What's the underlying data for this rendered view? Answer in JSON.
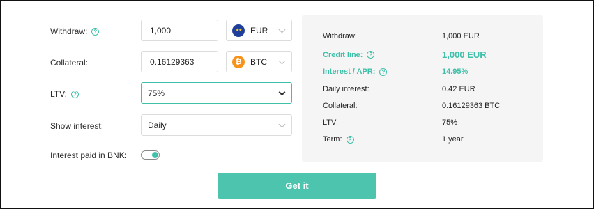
{
  "form": {
    "withdraw_label": "Withdraw:",
    "withdraw_value": "1,000",
    "withdraw_currency": "EUR",
    "collateral_label": "Collateral:",
    "collateral_value": "0.16129363",
    "collateral_currency": "BTC",
    "ltv_label": "LTV:",
    "ltv_value": "75%",
    "show_interest_label": "Show interest:",
    "show_interest_value": "Daily",
    "interest_bnk_label": "Interest paid in BNK:",
    "interest_bnk_on": true
  },
  "summary": {
    "withdraw_label": "Withdraw:",
    "withdraw_value": "1,000 EUR",
    "credit_line_label": "Credit line:",
    "credit_line_value": "1,000 EUR",
    "apr_label": "Interest / APR:",
    "apr_value": "14.95%",
    "daily_label": "Daily interest:",
    "daily_value": "0.42 EUR",
    "collateral_label": "Collateral:",
    "collateral_value": "0.16129363 BTC",
    "ltv_label": "LTV:",
    "ltv_value": "75%",
    "term_label": "Term:",
    "term_value": "1 year"
  },
  "cta_label": "Get it",
  "icons": {
    "help": "question-circle-icon",
    "eur": "eu-flag-icon",
    "btc": "bitcoin-icon",
    "chevron": "chevron-down-icon"
  },
  "colors": {
    "accent": "#3fc0a8",
    "button": "#4cc4ae",
    "panel": "#f5f5f5"
  }
}
